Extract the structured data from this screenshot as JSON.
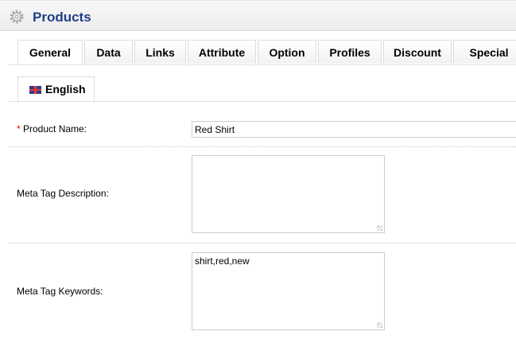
{
  "header": {
    "title": "Products",
    "icon": "gear-icon"
  },
  "tabs": [
    "General",
    "Data",
    "Links",
    "Attribute",
    "Option",
    "Profiles",
    "Discount",
    "Special"
  ],
  "active_tab": "General",
  "language_tab": {
    "label": "English",
    "icon": "uk-flag-icon"
  },
  "form": {
    "product_name": {
      "required": "*",
      "label": " Product Name:",
      "value": "Red Shirt"
    },
    "meta_description": {
      "label": "Meta Tag Description:",
      "value": ""
    },
    "meta_keywords": {
      "label": "Meta Tag Keywords:",
      "value": "shirt,red,new"
    }
  }
}
